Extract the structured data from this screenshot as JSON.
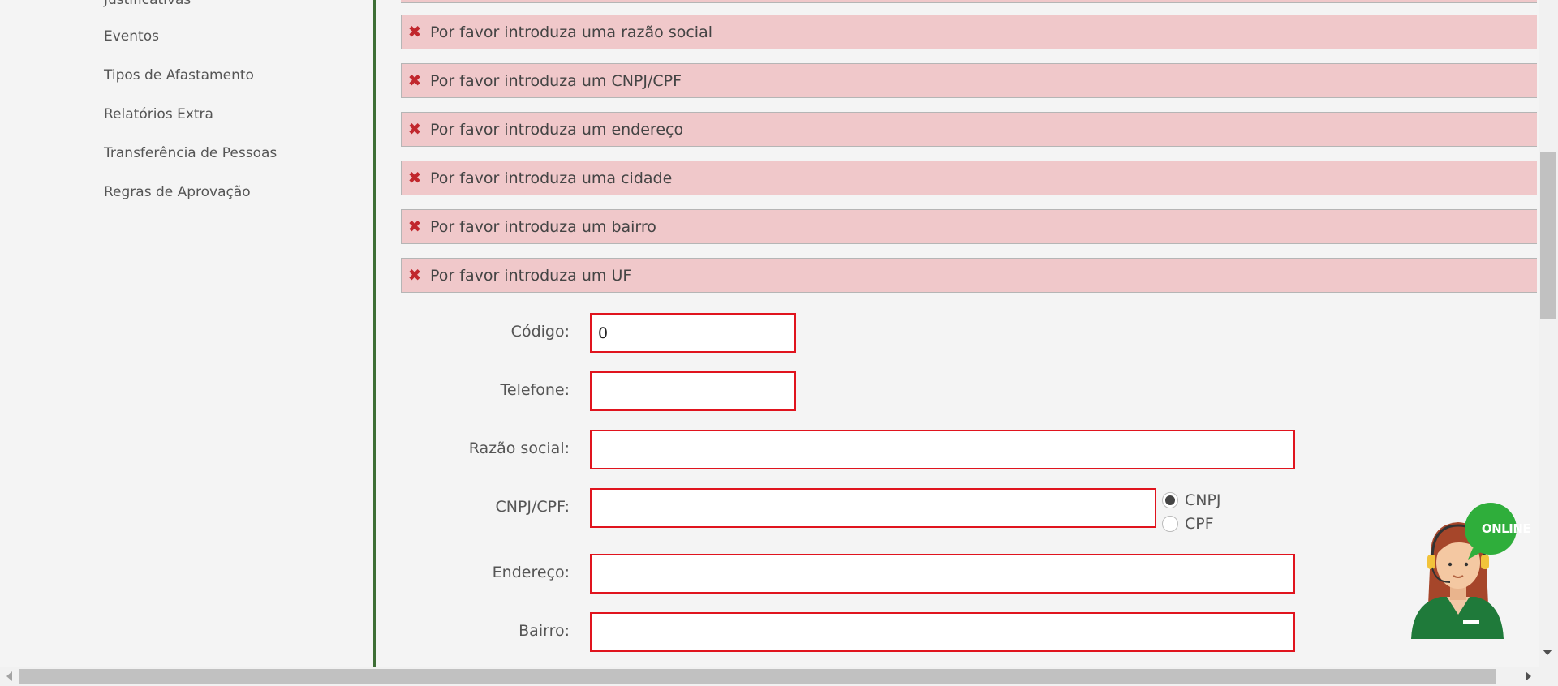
{
  "sidebar": {
    "items": [
      {
        "label": "Justificativas"
      },
      {
        "label": "Eventos"
      },
      {
        "label": "Tipos de Afastamento"
      },
      {
        "label": "Relatórios Extra"
      },
      {
        "label": "Transferência de Pessoas"
      },
      {
        "label": "Regras de Aprovação"
      }
    ]
  },
  "errors": [
    {
      "icon": "error-x-icon",
      "message": "Por favor introduza uma razão social"
    },
    {
      "icon": "error-x-icon",
      "message": "Por favor introduza um CNPJ/CPF"
    },
    {
      "icon": "error-x-icon",
      "message": "Por favor introduza um endereço"
    },
    {
      "icon": "error-x-icon",
      "message": "Por favor introduza uma cidade"
    },
    {
      "icon": "error-x-icon",
      "message": "Por favor introduza um bairro"
    },
    {
      "icon": "error-x-icon",
      "message": "Por favor introduza um UF"
    }
  ],
  "form": {
    "codigo": {
      "label": "Código:",
      "value": "0"
    },
    "telefone": {
      "label": "Telefone:",
      "value": ""
    },
    "razao_social": {
      "label": "Razão social:",
      "value": ""
    },
    "cnpj_cpf": {
      "label": "CNPJ/CPF:",
      "value": "",
      "options": [
        {
          "label": "CNPJ",
          "checked": true
        },
        {
          "label": "CPF",
          "checked": false
        }
      ]
    },
    "endereco": {
      "label": "Endereço:",
      "value": ""
    },
    "bairro": {
      "label": "Bairro:",
      "value": ""
    }
  },
  "support_widget": {
    "badge": "ONLINE",
    "icon": "support-agent-icon"
  },
  "colors": {
    "error_bg": "#f0c8ca",
    "error_icon": "#c1272d",
    "input_border": "#e0141e",
    "divider": "#3d6e35",
    "online_badge": "#2fae3b"
  }
}
